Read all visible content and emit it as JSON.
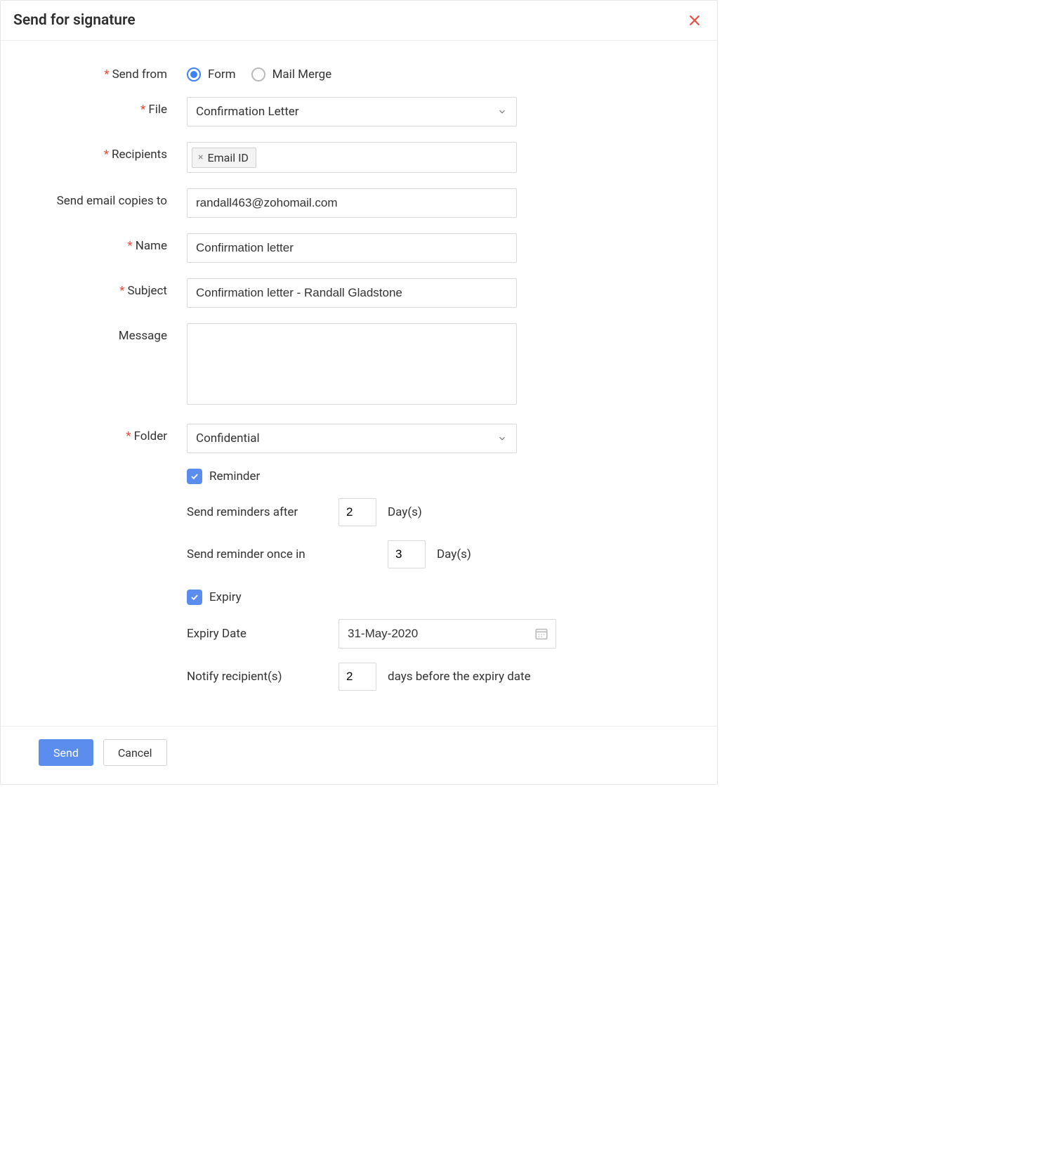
{
  "header": {
    "title": "Send for signature"
  },
  "labels": {
    "send_from": "Send from",
    "file": "File",
    "recipients": "Recipients",
    "email_copies": "Send email copies to",
    "name": "Name",
    "subject": "Subject",
    "message": "Message",
    "folder": "Folder",
    "reminder": "Reminder",
    "reminders_after": "Send reminders after",
    "reminder_once_in": "Send reminder once in",
    "expiry": "Expiry",
    "expiry_date": "Expiry Date",
    "notify_recipients": "Notify recipient(s)",
    "days": "Day(s)",
    "days_before": "days before the expiry date"
  },
  "send_from": {
    "options": {
      "form": "Form",
      "mail_merge": "Mail Merge"
    },
    "selected": "form"
  },
  "file": {
    "value": "Confirmation Letter"
  },
  "recipients": {
    "chips": [
      "Email ID"
    ]
  },
  "email_copies": {
    "value": "randall463@zohomail.com"
  },
  "name": {
    "value": "Confirmation letter"
  },
  "subject": {
    "value": "Confirmation letter - Randall Gladstone"
  },
  "message": {
    "value": ""
  },
  "folder": {
    "value": "Confidential"
  },
  "reminder": {
    "checked": true,
    "after_days": "2",
    "once_in_days": "3"
  },
  "expiry": {
    "checked": true,
    "date": "31-May-2020",
    "notify_days": "2"
  },
  "footer": {
    "send": "Send",
    "cancel": "Cancel"
  }
}
